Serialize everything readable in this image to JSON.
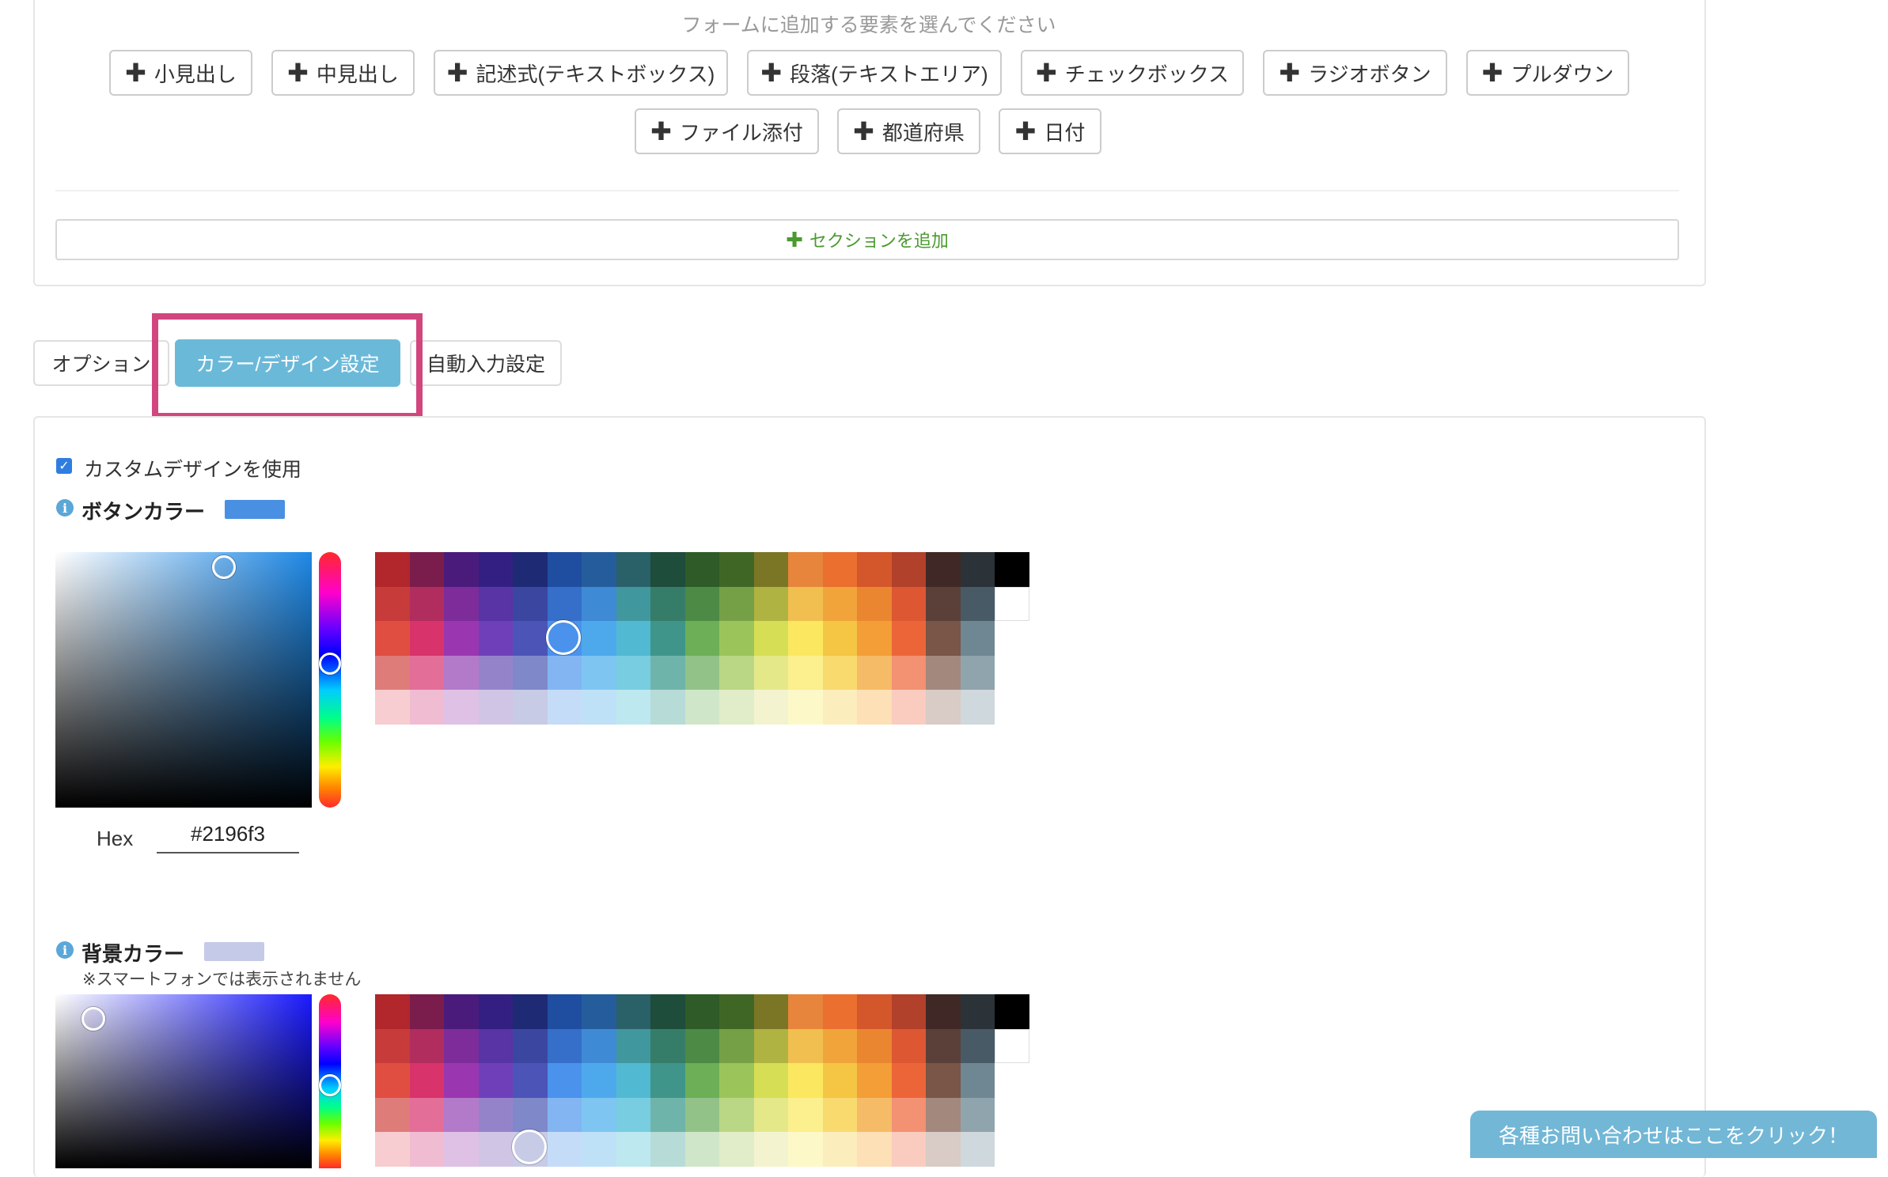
{
  "elements": {
    "hint": "フォームに追加する要素を選んでください",
    "row1": [
      "小見出し",
      "中見出し",
      "記述式(テキストボックス)",
      "段落(テキストエリア)",
      "チェックボックス",
      "ラジオボタン",
      "プルダウン"
    ],
    "row2": [
      "ファイル添付",
      "都道府県",
      "日付"
    ],
    "add_section": "セクションを追加"
  },
  "tabs": {
    "options": "オプション",
    "color_design": "カラー/デザイン設定",
    "auto_input": "自動入力設定",
    "active": "カラー/デザイン設定"
  },
  "design": {
    "use_custom_label": "カスタムデザインを使用",
    "use_custom_checked": true,
    "button_color": {
      "label": "ボタンカラー",
      "value": "#4a90e2",
      "hex_label": "Hex",
      "hex_value": "#2196f3",
      "picker_hue": "#1e88e5"
    },
    "background_color": {
      "label": "背景カラー",
      "value": "#c5cae9",
      "note": "※スマートフォンでは表示されません",
      "picker_hue": "#1a1aff"
    }
  },
  "palette_colors": [
    [
      "#b1272b",
      "#7a1d4c",
      "#4a1b7b",
      "#331f82",
      "#1f2a74",
      "#1f4da0",
      "#255d9c",
      "#2a6068",
      "#1e4d3c",
      "#2e5b28",
      "#406626",
      "#7a7625",
      "#e6853b",
      "#eb6f2f",
      "#d4562b",
      "#b1412a",
      "#3f2825",
      "#2b3238",
      "#000000"
    ],
    [
      "#c73b3b",
      "#b02d5e",
      "#7d2c9a",
      "#5834a4",
      "#3b46a0",
      "#356fc9",
      "#3f8ad4",
      "#41979e",
      "#367d69",
      "#4c8a45",
      "#76a046",
      "#afb341",
      "#f0bf4f",
      "#f0a43a",
      "#eb8630",
      "#dd5733",
      "#5b403a",
      "#485a66",
      "#ffffff"
    ],
    [
      "#e04e41",
      "#d8336b",
      "#9a37b0",
      "#6f3fba",
      "#4d54b7",
      "#4a92ec",
      "#4ea9ec",
      "#52b9d2",
      "#3f958a",
      "#6caf56",
      "#9bc55a",
      "#d6de55",
      "#fbe860",
      "#f5c544",
      "#f39e36",
      "#ec6538",
      "#795648",
      "#6f8793",
      null
    ],
    [
      "#de7c79",
      "#e36e98",
      "#b27ac9",
      "#9583ca",
      "#7f88c9",
      "#82b5f2",
      "#7ec5f2",
      "#78cde0",
      "#6fb4aa",
      "#92c288",
      "#b9d784",
      "#e4e889",
      "#fcef8d",
      "#f9da6f",
      "#f5bb66",
      "#f39173",
      "#a3887e",
      "#90a4ae",
      null
    ],
    [
      "#f7cdd1",
      "#f0bcd2",
      "#dfc1e5",
      "#d1c5e6",
      "#c8cbe6",
      "#c5dcf8",
      "#bfe1f7",
      "#bde8ef",
      "#b7dbd7",
      "#d0e6c9",
      "#e1ecc8",
      "#f3f4cf",
      "#fdf8c7",
      "#fcedbd",
      "#fde0b5",
      "#f9ccbf",
      "#d9cbc6",
      "#cfd8dc",
      null
    ]
  ],
  "contact_button": "各種お問い合わせはここをクリック！"
}
